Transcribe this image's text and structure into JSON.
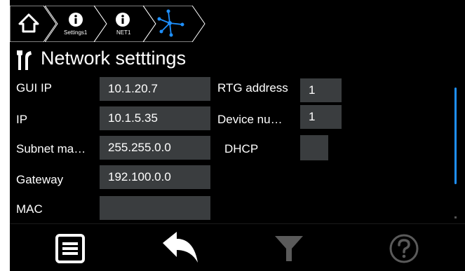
{
  "breadcrumb": {
    "items": [
      {
        "icon": "home-icon"
      },
      {
        "icon": "info-icon",
        "label": "Settings1"
      },
      {
        "icon": "info-icon",
        "label": "NET1"
      },
      {
        "icon": "network-icon"
      }
    ]
  },
  "page": {
    "title": "Network setttings",
    "icon": "tools-icon"
  },
  "form": {
    "left": [
      {
        "label": "GUI IP",
        "value": "10.1.20.7"
      },
      {
        "label": "IP",
        "value": "10.1.5.35"
      },
      {
        "label": "Subnet ma…",
        "value": "255.255.0.0"
      },
      {
        "label": "Gateway",
        "value": "192.100.0.0"
      },
      {
        "label": "MAC",
        "value": ""
      }
    ],
    "right": [
      {
        "label": "RTG address",
        "value": "1"
      },
      {
        "label": "Device nu…",
        "value": "1"
      },
      {
        "label": "DHCP",
        "value": ""
      }
    ]
  },
  "toolbar": {
    "items": [
      {
        "icon": "menu-icon",
        "enabled": true
      },
      {
        "icon": "back-arrow-icon",
        "enabled": true
      },
      {
        "icon": "filter-icon",
        "enabled": false
      },
      {
        "icon": "help-icon",
        "enabled": false
      }
    ]
  },
  "colors": {
    "accent": "#1e90ff",
    "field_bg": "#3a3d3f",
    "disabled": "#5a5a5a"
  }
}
